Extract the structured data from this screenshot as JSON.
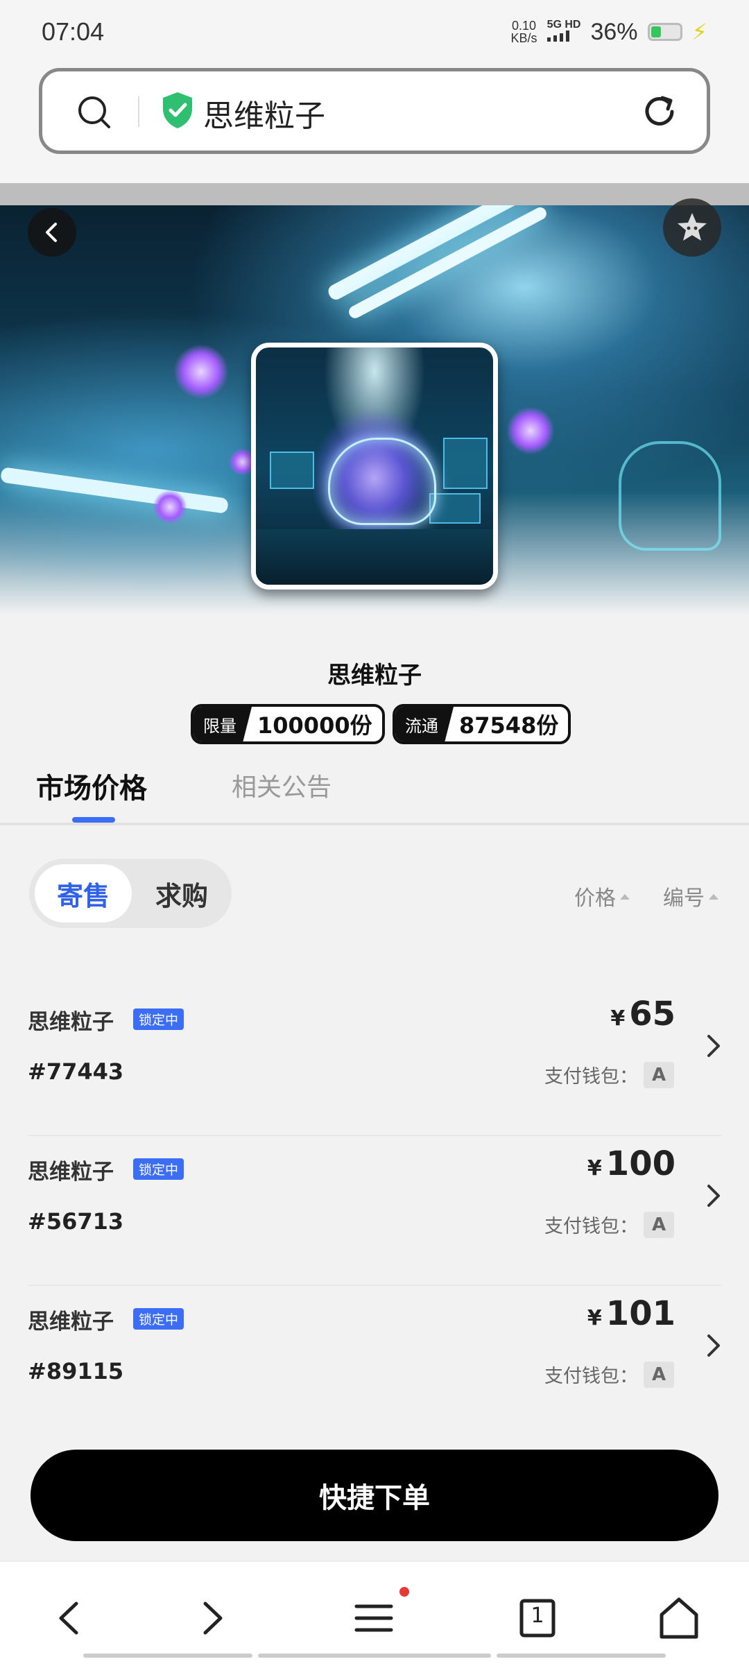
{
  "status_bar": {
    "time": "07:04",
    "net_speed_value": "0.10",
    "net_speed_unit": "KB/s",
    "signal_label": "5G HD",
    "battery_percent": "36%"
  },
  "address_bar": {
    "title": "思维粒子"
  },
  "product": {
    "name": "思维粒子",
    "limit_key": "限量",
    "limit_value": "100000份",
    "circulation_key": "流通",
    "circulation_value": "87548份"
  },
  "tabs": {
    "market_price": "市场价格",
    "announcements": "相关公告"
  },
  "segment": {
    "consign": "寄售",
    "buy_request": "求购"
  },
  "sort": {
    "price": "价格",
    "number": "编号"
  },
  "listings": [
    {
      "name": "思维粒子",
      "status": "锁定中",
      "number": "#77443",
      "currency": "¥",
      "price": "65",
      "wallet_label": "支付钱包：",
      "wallet": "A"
    },
    {
      "name": "思维粒子",
      "status": "锁定中",
      "number": "#56713",
      "currency": "¥",
      "price": "100",
      "wallet_label": "支付钱包：",
      "wallet": "A"
    },
    {
      "name": "思维粒子",
      "status": "锁定中",
      "number": "#89115",
      "currency": "¥",
      "price": "101",
      "wallet_label": "支付钱包：",
      "wallet": "A"
    }
  ],
  "cta": {
    "label": "快捷下单"
  },
  "bottom_nav": {
    "tab_count": "1"
  },
  "colors": {
    "accent": "#3b6ef5",
    "cta": "#000000",
    "shield": "#2fbf71"
  }
}
